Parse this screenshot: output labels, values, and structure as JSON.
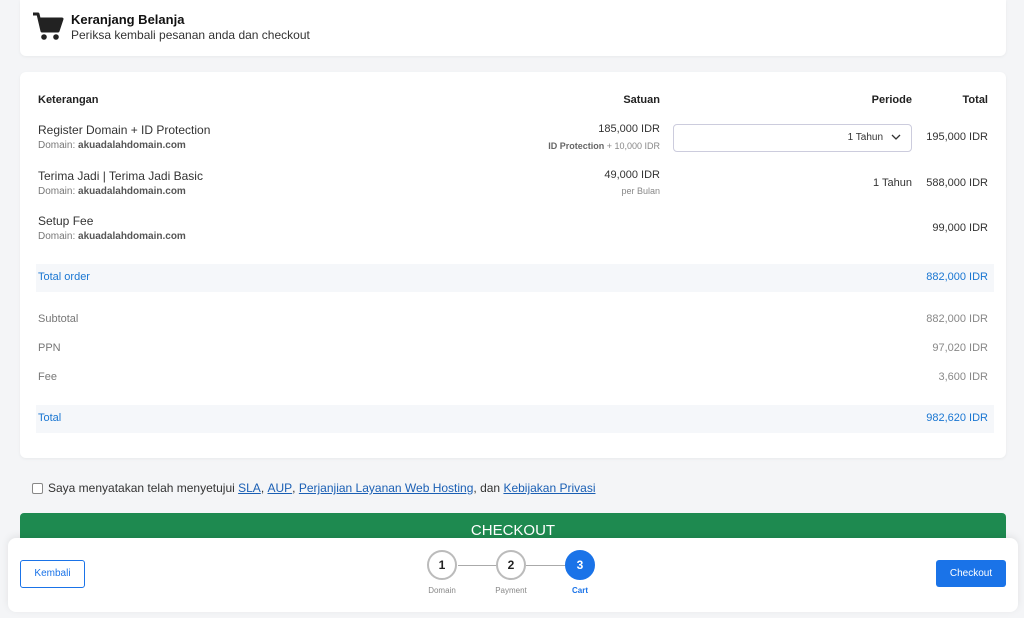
{
  "header": {
    "title": "Keranjang Belanja",
    "subtitle": "Periksa kembali pesanan anda dan checkout",
    "icon": "cart-icon"
  },
  "table": {
    "headers": {
      "description": "Keterangan",
      "unit": "Satuan",
      "period": "Periode",
      "total": "Total"
    },
    "items": [
      {
        "name": "Register Domain + ID Protection",
        "domain_label": "Domain: ",
        "domain": "akuadalahdomain.com",
        "unit_price": "185,000 IDR",
        "unit_note_bold": "ID Protection",
        "unit_note": " + 10,000 IDR",
        "period_selected": "1 Tahun",
        "total": "195,000 IDR"
      },
      {
        "name": "Terima Jadi | Terima Jadi Basic",
        "domain_label": "Domain: ",
        "domain": "akuadalahdomain.com",
        "unit_price": "49,000 IDR",
        "unit_note": "per Bulan",
        "period": "1 Tahun",
        "total": "588,000 IDR"
      },
      {
        "name": "Setup Fee",
        "domain_label": "Domain: ",
        "domain": "akuadalahdomain.com",
        "total": "99,000 IDR"
      }
    ],
    "total_order": {
      "label": "Total order",
      "value": "882,000 IDR"
    },
    "summary": [
      {
        "label": "Subtotal",
        "value": "882,000 IDR"
      },
      {
        "label": "PPN",
        "value": "97,020 IDR"
      },
      {
        "label": "Fee",
        "value": "3,600 IDR"
      }
    ],
    "grand_total": {
      "label": "Total",
      "value": "982,620 IDR"
    }
  },
  "agreement": {
    "prefix": "Saya menyatakan telah menyetujui ",
    "sla": "SLA",
    "sep1": ", ",
    "aup": "AUP",
    "sep2": ", ",
    "hosting": "Perjanjian Layanan Web Hosting",
    "sep3": ", dan ",
    "privacy": "Kebijakan Privasi",
    "checked": false
  },
  "checkout_bar": {
    "label": "CHECKOUT"
  },
  "footer": {
    "back_label": "Kembali",
    "checkout_label": "Checkout",
    "steps": [
      {
        "number": "1",
        "label": "Domain"
      },
      {
        "number": "2",
        "label": "Payment"
      },
      {
        "number": "3",
        "label": "Cart"
      }
    ]
  },
  "colors": {
    "accent": "#1a73e8",
    "checkout_green": "#1e8a50",
    "link": "#1a5fb4"
  }
}
